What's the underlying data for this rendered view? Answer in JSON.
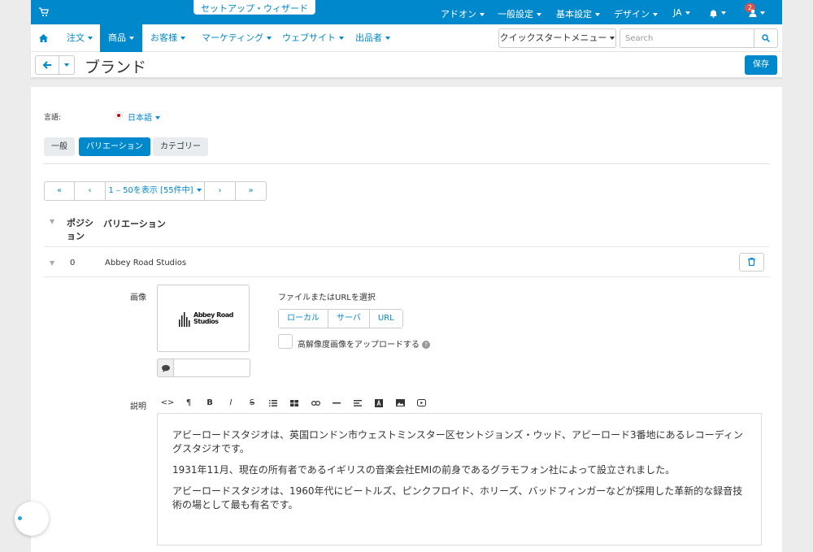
{
  "topbar": {
    "wizard": "セットアップ・ウィザード",
    "items": [
      "アドオン",
      "一般設定",
      "基本設定",
      "デザイン",
      "JA"
    ],
    "notification_count": "2"
  },
  "mainnav": {
    "items": [
      "注文",
      "商品",
      "お客様",
      "マーケティング",
      "ウェブサイト",
      "出品者"
    ],
    "active": "商品",
    "quickstart": "クイックスタートメニュー",
    "search_placeholder": "Search"
  },
  "titlebar": {
    "title": "ブランド",
    "save": "保存"
  },
  "language": {
    "label": "言語:",
    "value": "日本語"
  },
  "tabs": [
    "一般",
    "バリエーション",
    "カテゴリー"
  ],
  "pager": {
    "first": "«",
    "prev": "‹",
    "range": "1 – 50を表示 [55件中]",
    "next": "›",
    "last": "»"
  },
  "table": {
    "headers": [
      "ポジション",
      "バリエーション"
    ],
    "row": {
      "position": "0",
      "name": "Abbey Road Studios"
    }
  },
  "image_field": {
    "label": "画像",
    "logo_line1": "Abbey Road",
    "logo_line2": "Studios",
    "select_label": "ファイルまたはURLを選択",
    "sources": [
      "ローカル",
      "サーバ",
      "URL"
    ],
    "hires_label": "高解像度画像をアップロードする"
  },
  "description": {
    "label": "説明",
    "toolbar": [
      "<>",
      "¶",
      "B",
      "I",
      "S",
      "list-ul",
      "table",
      "link",
      "hr",
      "align",
      "A",
      "image",
      "video"
    ],
    "paragraphs": [
      "アビーロードスタジオは、英国ロンドン市ウェストミンスター区セントジョンズ・ウッド、アビーロード3番地にあるレコーディングスタジオです。",
      "1931年11月、現在の所有者であるイギリスの音楽会社EMIの前身であるグラモフォン社によって設立されました。",
      "アビーロードスタジオは、1960年代にビートルズ、ピンクフロイド、ホリーズ、バッドフィンガーなどが採用した革新的な録音技術の場として最も有名です。"
    ]
  },
  "colors": {
    "accent": "#0088cc",
    "badge": "#d9534f"
  }
}
